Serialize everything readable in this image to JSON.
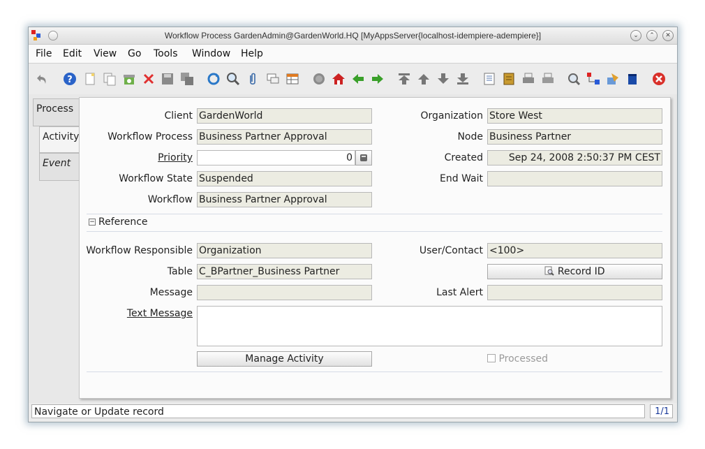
{
  "window": {
    "title": "Workflow Process  GardenAdmin@GardenWorld.HQ [MyAppsServer{localhost-idempiere-adempiere}]"
  },
  "menu": [
    "File",
    "Edit",
    "View",
    "Go",
    "Tools",
    "Window",
    "Help"
  ],
  "toolbar": {
    "icons": [
      "undo-icon",
      "help-icon",
      "new-icon",
      "copy-icon",
      "archive-icon",
      "delete-icon",
      "save-icon",
      "save-new-icon",
      "refresh-icon",
      "find-icon",
      "attachment-icon",
      "chat-icon",
      "grid-toggle-icon",
      "history-icon",
      "home-icon",
      "back-icon",
      "forward-icon",
      "first-icon",
      "previous-icon",
      "next-icon",
      "last-icon",
      "report-icon",
      "archive-viewer-icon",
      "print-icon",
      "print-preview-icon",
      "zoom-across-icon",
      "active-workflows-icon",
      "request-icon",
      "product-info-icon",
      "exit-icon"
    ]
  },
  "tabs": [
    "Process",
    "Activity",
    "Event"
  ],
  "form": {
    "client_label": "Client",
    "client_value": "GardenWorld",
    "organization_label": "Organization",
    "organization_value": "Store West",
    "workflow_process_label": "Workflow Process",
    "workflow_process_value": "Business Partner Approval",
    "node_label": "Node",
    "node_value": "Business Partner",
    "priority_label": "Priority",
    "priority_value": "0",
    "created_label": "Created",
    "created_value": "Sep 24, 2008 2:50:37 PM CEST",
    "workflow_state_label": "Workflow State",
    "workflow_state_value": "Suspended",
    "end_wait_label": "End Wait",
    "end_wait_value": "",
    "workflow_label": "Workflow",
    "workflow_value": "Business Partner Approval",
    "reference_header": "Reference",
    "responsible_label": "Workflow Responsible",
    "responsible_value": "Organization",
    "user_contact_label": "User/Contact",
    "user_contact_value": "<100>",
    "table_label": "Table",
    "table_value": "C_BPartner_Business Partner",
    "record_id_button": "Record ID",
    "message_label": "Message",
    "message_value": "",
    "last_alert_label": "Last Alert",
    "last_alert_value": "",
    "text_message_label": "Text Message",
    "text_message_value": "",
    "manage_activity_button": "Manage Activity",
    "processed_label": "Processed"
  },
  "status": {
    "text": "Navigate or Update record",
    "count": "1/1"
  },
  "colors": {
    "readonly_field": "#ecece2",
    "exit": "#d9302a",
    "nav_green": "#3aa02a",
    "home_red": "#cc2222"
  }
}
